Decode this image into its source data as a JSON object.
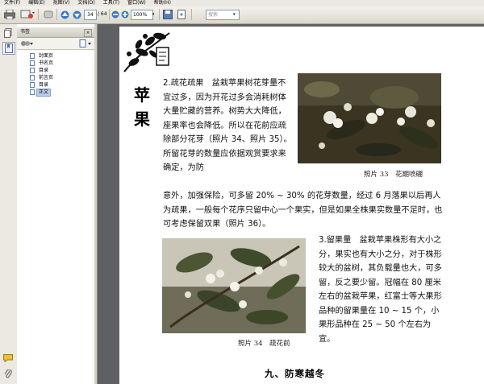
{
  "menu": {
    "items": [
      "文件(F)",
      "编辑(E)",
      "视图(V)",
      "文档(D)",
      "工具(T)",
      "窗口(W)",
      "帮助(H)"
    ]
  },
  "toolbar": {
    "page_current": "34",
    "page_total": "/ 64",
    "zoom": "100%",
    "find_placeholder": "搜索"
  },
  "panel": {
    "title": "书签",
    "close_label": "×",
    "bookmarks": [
      {
        "label": "封面页",
        "selected": false
      },
      {
        "label": "书名页",
        "selected": false
      },
      {
        "label": "目录",
        "selected": false
      },
      {
        "label": "前言页",
        "selected": false
      },
      {
        "label": "目录",
        "selected": false
      },
      {
        "label": "正文",
        "selected": true
      }
    ]
  },
  "document": {
    "vertical_title": "苹果",
    "paragraph1": "2.疏花疏果　盆栽苹果树花芽量不宜过多，因为开花过多会消耗树体大量贮藏的营养。树势大大降低，座果率也会降低。所以在花前应疏除部分花芽（照片 34、照片 35）。所留花芽的数量应依据观赏要求来确定，为防",
    "paragraph1_cont": "意外，加强保险，可多留 20% ~ 30% 的花芽数量，经过 6 月落果以后再人为疏果，一般每个花序只留中心一个果实，但是如果全株果实数量不足时，也可考虑保留双果（照片 36）。",
    "paragraph2": "3.留果量　盆栽苹果株形有大小之分，果实也有大小之分，对于株形较大的盆树，其负载量也大，可多留，反之要少留。冠幅在 80 厘米左右的盆栽苹果，红富士等大果形品种的留果量在 10 ~ 15 个，小果形品种在 25 ~ 50 个左右为宜。",
    "caption33": "照片 33　花期喷硼",
    "caption34": "照片 34　疏花前",
    "section_heading": "九、防寒越冬"
  },
  "colors": {
    "viewer_bg": "#5f6062",
    "chrome": "#ece9e2",
    "selection": "#b9cfe9"
  }
}
